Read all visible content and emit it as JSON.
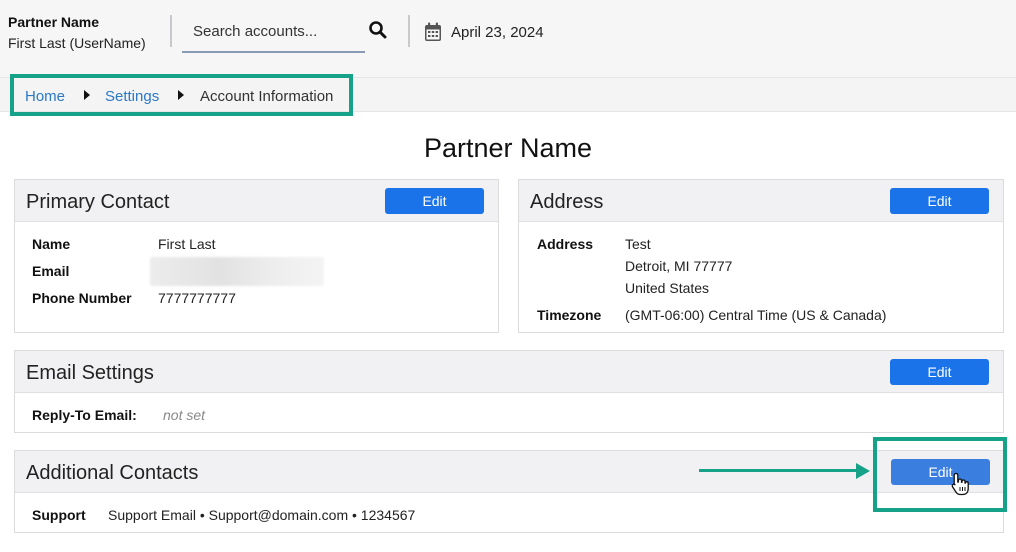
{
  "header": {
    "partner_name": "Partner Name",
    "user_label": "First Last (UserName)",
    "search_placeholder": "Search accounts...",
    "date": "April 23, 2024"
  },
  "breadcrumb": {
    "home": "Home",
    "settings": "Settings",
    "current": "Account Information"
  },
  "page_title": "Partner Name",
  "primary_contact": {
    "title": "Primary Contact",
    "edit_label": "Edit",
    "name_label": "Name",
    "name_value": "First Last",
    "email_label": "Email",
    "phone_label": "Phone Number",
    "phone_value": "7777777777"
  },
  "address": {
    "title": "Address",
    "edit_label": "Edit",
    "address_label": "Address",
    "line1": "Test",
    "line2": "Detroit, MI 77777",
    "line3": "United States",
    "timezone_label": "Timezone",
    "timezone_value": "(GMT-06:00) Central Time (US & Canada)"
  },
  "email_settings": {
    "title": "Email Settings",
    "edit_label": "Edit",
    "reply_to_label": "Reply-To Email:",
    "reply_to_value": "not set"
  },
  "additional_contacts": {
    "title": "Additional Contacts",
    "edit_label": "Edit",
    "support_label": "Support",
    "support_value": "Support Email • Support@domain.com • 1234567"
  },
  "colors": {
    "accent_button": "#1a73e8",
    "highlight": "#15a288",
    "link": "#2b78c5"
  },
  "icons": [
    "search-icon",
    "calendar-icon",
    "caret-right-icon",
    "hand-pointer-icon",
    "callout-arrow"
  ]
}
